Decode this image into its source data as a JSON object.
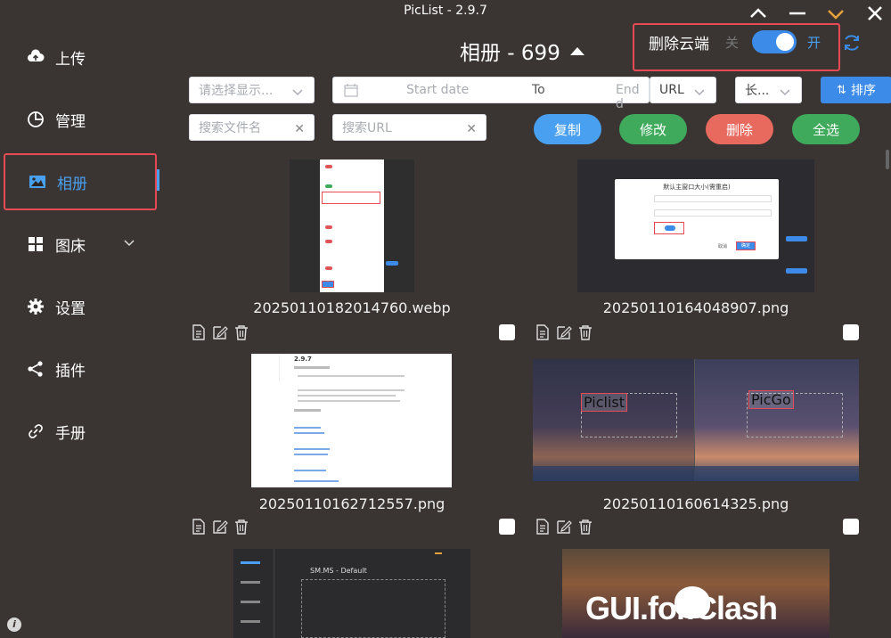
{
  "window": {
    "title": "PicList - 2.9.7"
  },
  "sidebar": {
    "items": [
      {
        "label": "上传",
        "icon": "cloud-upload-icon"
      },
      {
        "label": "管理",
        "icon": "pie-chart-icon"
      },
      {
        "label": "相册",
        "icon": "image-icon"
      },
      {
        "label": "图床",
        "icon": "grid-icon"
      },
      {
        "label": "设置",
        "icon": "gear-icon"
      },
      {
        "label": "插件",
        "icon": "share-icon"
      },
      {
        "label": "手册",
        "icon": "link-icon"
      }
    ]
  },
  "header": {
    "album_title": "相册 - 699",
    "delete_cloud_label": "删除云端",
    "toggle_off_label": "关",
    "toggle_on_label": "开",
    "toggle_on": true
  },
  "filters": {
    "display_select_placeholder": "请选择显示...",
    "start_date_placeholder": "Start date",
    "date_separator": "To",
    "end_date_placeholder": "End d",
    "url_select_value": "URL",
    "length_select_value": "长...",
    "sort_label": "排序",
    "search_filename_placeholder": "搜索文件名",
    "search_url_placeholder": "搜索URL"
  },
  "actions": {
    "copy_label": "复制",
    "edit_label": "修改",
    "delete_label": "删除",
    "select_all_label": "全选"
  },
  "colors": {
    "accent": "#3d8be8",
    "copy": "#4aa0f0",
    "edit": "#3faa5c",
    "delete": "#e86a5f",
    "select_all": "#3faa5c",
    "highlight_box": "#e84a55"
  },
  "gallery": [
    {
      "name": "20250110182014760.webp"
    },
    {
      "name": "20250110164048907.png"
    },
    {
      "name": "20250110162712557.png"
    },
    {
      "name": "20250110160614325.png"
    },
    {
      "name": ""
    },
    {
      "name": ""
    }
  ],
  "thumbnails": {
    "settings_dialog_title": "默认主窗口大小(需重启)",
    "settings_dialog_cancel": "取消",
    "settings_dialog_confirm": "确定",
    "piclist_label": "Piclist",
    "picgo_label": "PicGo",
    "smms_label": "SM.MS - Default",
    "release_version": "2.9.7",
    "clash_banner": "GUI.for.Clash"
  }
}
